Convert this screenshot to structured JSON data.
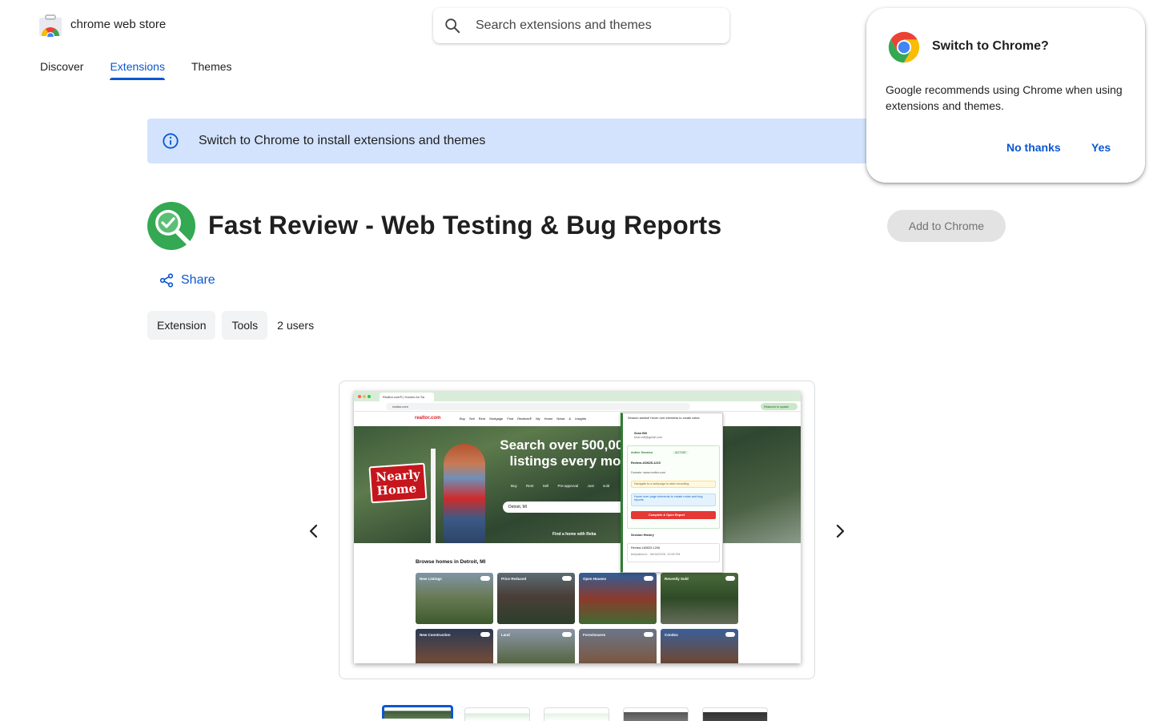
{
  "header": {
    "brand": "chrome web store",
    "search_placeholder": "Search extensions and themes",
    "nav": [
      {
        "label": "Discover",
        "active": false
      },
      {
        "label": "Extensions",
        "active": true
      },
      {
        "label": "Themes",
        "active": false
      }
    ]
  },
  "banner": {
    "text": "Switch to Chrome to install extensions and themes",
    "icon": "info-icon"
  },
  "extension": {
    "title": "Fast Review - Web Testing & Bug Reports",
    "icon": "magnifier-check-icon",
    "add_button": "Add to Chrome",
    "share": "Share",
    "chips": [
      "Extension",
      "Tools"
    ],
    "users": "2 users"
  },
  "screenshot": {
    "tab_title": "Realtor.com® | Homes for Sa",
    "url": "realtor.com",
    "update_button": "Relaunch to update",
    "site_logo": "realtor.com",
    "site_nav": "Buy Sell Rent Mortgage Find Realtors® My Home News & Insights",
    "sign_text": "Nearly Home",
    "hero_heading": "Search over 500,000 listings every mo",
    "hero_tabs": "Buy Rent Sell Pre-approval Just sold",
    "hero_input": "Detroit, MI",
    "hero_cta": "Find a home with Reba",
    "browse_heading": "Browse homes in Detroit, MI",
    "cards": [
      "New Listings",
      "Price Reduced",
      "Open Houses",
      "Recently Sold",
      "New Construction",
      "Land",
      "Foreclosures",
      "Condos"
    ],
    "popup": {
      "header": "Session started! Hover over elements to create notes",
      "user_name": "Sean Bill",
      "user_email": "bean.bill@gmail.com",
      "active_label": "Active Session",
      "active_badge": "ACTIVE",
      "review_id": "Review-160625-1215",
      "domain": "Domain: www.realtor.com",
      "warning": "Navigate to a webpage to start recording",
      "hint": "Hover over page elements to create notes and bug reports",
      "complete_button": "Complete & Open Report",
      "history_label": "Session History",
      "history_item": "Review-160625-1206",
      "history_meta": "templates.io · 06/16/2025, 12:06 PM"
    }
  },
  "carousel": {
    "prev_icon": "chevron-left-icon",
    "next_icon": "chevron-right-icon",
    "thumbnail_count": 5
  },
  "switch_popup": {
    "title": "Switch to Chrome?",
    "body": "Google recommends using Chrome when using extensions and themes.",
    "no_button": "No thanks",
    "yes_button": "Yes"
  },
  "colors": {
    "accent": "#0b57d0",
    "banner_bg": "#d3e3fd",
    "ext_icon_green": "#34a853",
    "disabled_btn_bg": "#e3e3e3"
  }
}
